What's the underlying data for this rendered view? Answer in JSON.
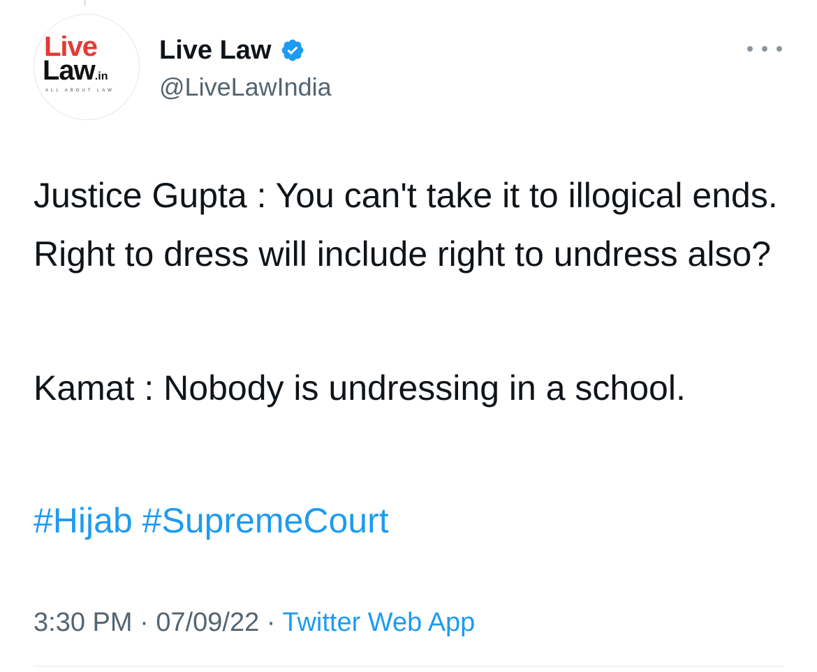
{
  "author": {
    "display_name": "Live Law",
    "handle": "@LiveLawIndia",
    "verified": true,
    "avatar_logo": {
      "line1": "Live",
      "line2": "Law",
      "suffix": ".in",
      "tagline": "ALL ABOUT LAW"
    }
  },
  "tweet": {
    "paragraphs": [
      "Justice Gupta : You can't take it to illogical ends. Right to dress will include right to undress also?",
      "Kamat : Nobody is undressing in a school."
    ],
    "hashtags": [
      "#Hijab",
      "#SupremeCourt"
    ]
  },
  "meta": {
    "time": "3:30 PM",
    "separator": "·",
    "date": "07/09/22",
    "source": "Twitter Web App"
  },
  "icons": {
    "verified": "verified-badge-icon",
    "more": "more-options-icon"
  },
  "colors": {
    "text": "#0f1419",
    "secondary": "#536471",
    "link": "#1d9bf0",
    "logo_red": "#e53935"
  }
}
